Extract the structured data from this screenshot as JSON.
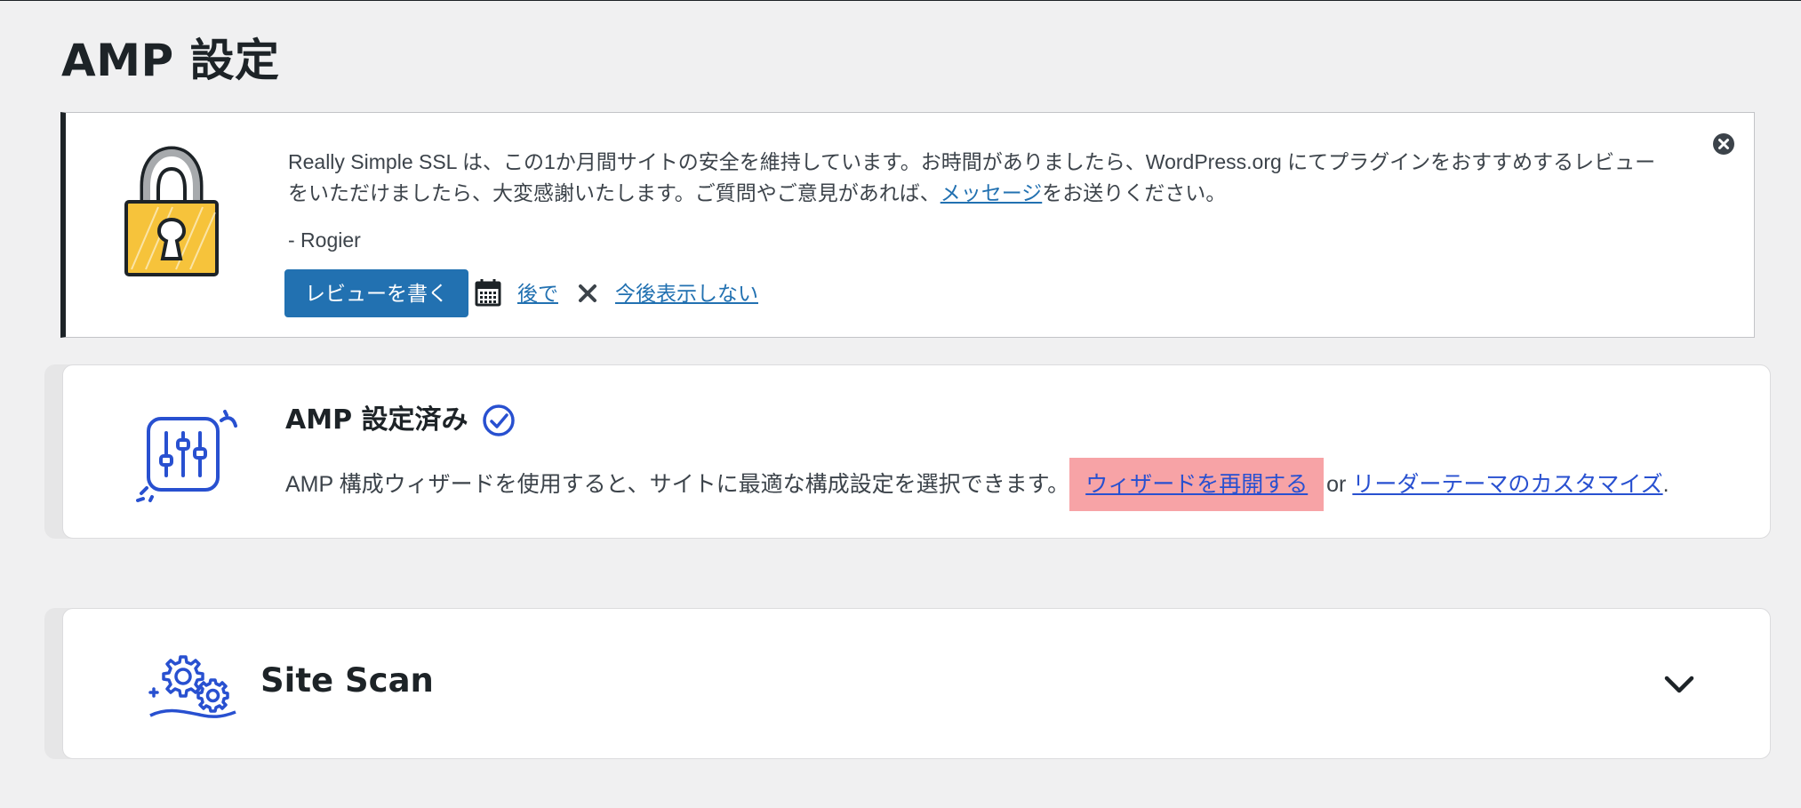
{
  "page": {
    "title": "AMP 設定"
  },
  "notice": {
    "message_part1": "Really Simple SSL は、この1か月間サイトの安全を維持しています。お時間がありましたら、WordPress.org にてプラグインをおすすめするレビューをいただけましたら、大変感謝いたします。ご質問やご意見があれば、",
    "message_link": "メッセージ",
    "message_part2": "をお送りください。",
    "signature": "- Rogier",
    "review_button": "レビューを書く",
    "later_link": "後で",
    "never_link": "今後表示しない",
    "icons": [
      "lock-icon",
      "calendar-icon",
      "close-x-icon",
      "dismiss-circle-icon"
    ]
  },
  "amp_card": {
    "title": "AMP 設定済み",
    "description": "AMP 構成ウィザードを使用すると、サイトに最適な構成設定を選択できます。",
    "reopen_link": "ウィザードを再開する",
    "or_text": "or",
    "customize_link": "リーダーテーマのカスタマイズ",
    "period": ".",
    "icons": [
      "sliders-icon",
      "check-circle-icon"
    ]
  },
  "scan_card": {
    "title": "Site Scan",
    "icons": [
      "gears-icon",
      "chevron-down-icon"
    ]
  },
  "colors": {
    "background": "#f0f0f1",
    "wp_blue": "#2271b1",
    "amp_blue": "#2850d0",
    "highlight": "#f7a3a6",
    "lock_yellow": "#f6c33b"
  }
}
